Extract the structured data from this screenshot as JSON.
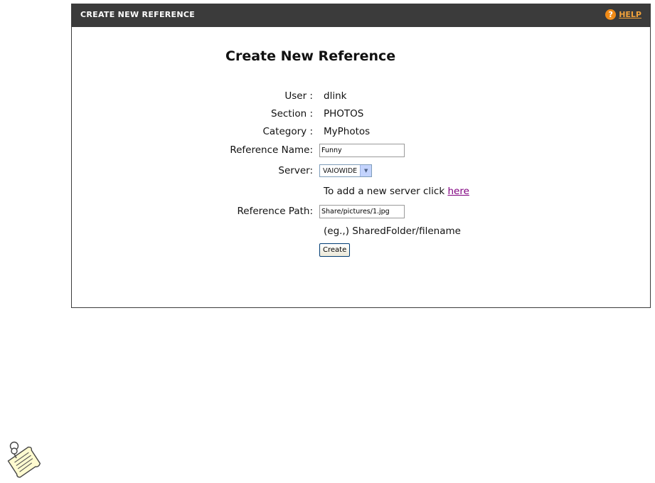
{
  "header": {
    "title": "CREATE NEW REFERENCE",
    "help_label": "HELP",
    "help_icon": "?"
  },
  "page_title": "Create New Reference",
  "form": {
    "user": {
      "label": "User :",
      "value": "dlink"
    },
    "section": {
      "label": "Section :",
      "value": "PHOTOS"
    },
    "category": {
      "label": "Category :",
      "value": "MyPhotos"
    },
    "reference_name": {
      "label": "Reference Name:",
      "value": "Funny"
    },
    "server": {
      "label": "Server:",
      "selected": "VAIOWIDE"
    },
    "add_server": {
      "text": "To add a new server click ",
      "link": "here"
    },
    "reference_path": {
      "label": "Reference Path:",
      "value": "Share/pictures/1.jpg"
    },
    "path_hint": "(eg.,) SharedFolder/filename",
    "create_button": "Create"
  },
  "colors": {
    "header_bg": "#3b3b3b",
    "help_accent": "#f08a16",
    "visited_link": "#800080"
  },
  "icons": {
    "help": "question-circle-icon",
    "note": "note-pushpin-icon"
  }
}
